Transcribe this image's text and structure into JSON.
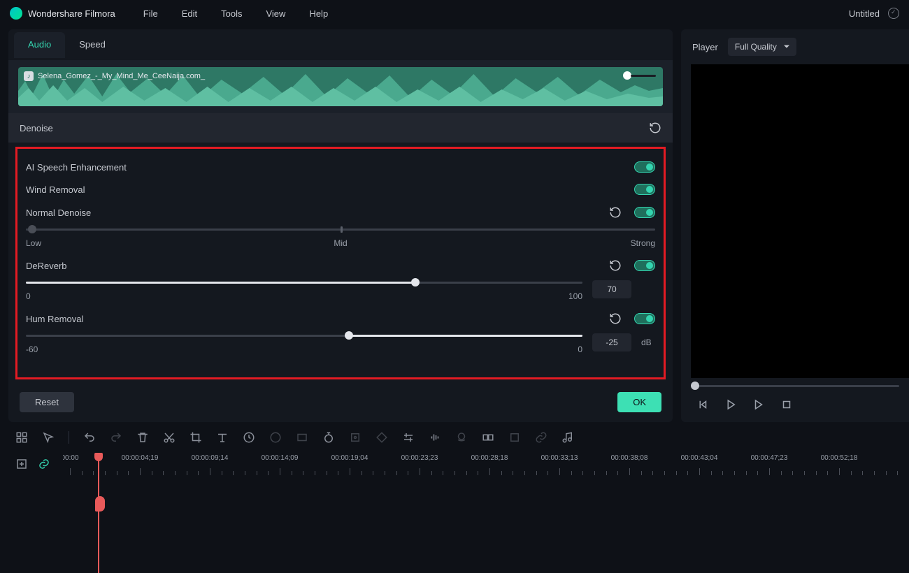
{
  "brand": "Wondershare Filmora",
  "menu": [
    "File",
    "Edit",
    "Tools",
    "View",
    "Help"
  ],
  "doc_title": "Untitled",
  "tabs": {
    "audio": "Audio",
    "speed": "Speed"
  },
  "clip": {
    "name": "Selena_Gomez_-_My_Mind_Me_CeeNaija.com_"
  },
  "section": "Denoise",
  "controls": {
    "ai_speech": "AI Speech Enhancement",
    "wind": "Wind Removal",
    "normal": "Normal Denoise",
    "normal_labels": {
      "low": "Low",
      "mid": "Mid",
      "strong": "Strong"
    },
    "dereverb": "DeReverb",
    "dereverb_val": "70",
    "dereverb_min": "0",
    "dereverb_max": "100",
    "hum": "Hum Removal",
    "hum_val": "-25",
    "hum_unit": "dB",
    "hum_min": "-60",
    "hum_max": "0"
  },
  "buttons": {
    "reset": "Reset",
    "ok": "OK"
  },
  "player": {
    "label": "Player",
    "quality": "Full Quality"
  },
  "timeline": {
    "marks": [
      "00:00",
      "00:00:04;19",
      "00:00:09;14",
      "00:00:14;09",
      "00:00:19;04",
      "00:00:23;23",
      "00:00:28;18",
      "00:00:33;13",
      "00:00:38;08",
      "00:00:43;04",
      "00:00:47;23",
      "00:00:52;18"
    ]
  }
}
